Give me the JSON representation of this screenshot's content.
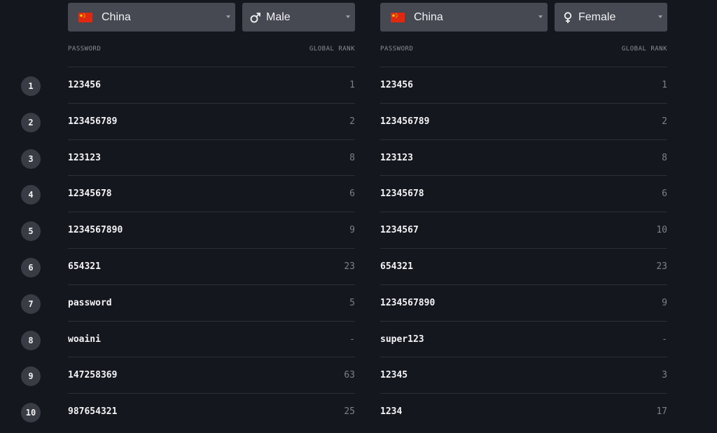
{
  "left": {
    "country": "China",
    "gender": "Male",
    "header_password": "PASSWORD",
    "header_rank": "GLOBAL RANK",
    "rows": [
      {
        "password": "123456",
        "rank": "1"
      },
      {
        "password": "123456789",
        "rank": "2"
      },
      {
        "password": "123123",
        "rank": "8"
      },
      {
        "password": "12345678",
        "rank": "6"
      },
      {
        "password": "1234567890",
        "rank": "9"
      },
      {
        "password": "654321",
        "rank": "23"
      },
      {
        "password": "password",
        "rank": "5"
      },
      {
        "password": "woaini",
        "rank": "-"
      },
      {
        "password": "147258369",
        "rank": "63"
      },
      {
        "password": "987654321",
        "rank": "25"
      }
    ]
  },
  "right": {
    "country": "China",
    "gender": "Female",
    "header_password": "PASSWORD",
    "header_rank": "GLOBAL RANK",
    "rows": [
      {
        "password": "123456",
        "rank": "1"
      },
      {
        "password": "123456789",
        "rank": "2"
      },
      {
        "password": "123123",
        "rank": "8"
      },
      {
        "password": "12345678",
        "rank": "6"
      },
      {
        "password": "1234567",
        "rank": "10"
      },
      {
        "password": "654321",
        "rank": "23"
      },
      {
        "password": "1234567890",
        "rank": "9"
      },
      {
        "password": "super123",
        "rank": "-"
      },
      {
        "password": "12345",
        "rank": "3"
      },
      {
        "password": "1234",
        "rank": "17"
      }
    ]
  },
  "row_numbers": [
    "1",
    "2",
    "3",
    "4",
    "5",
    "6",
    "7",
    "8",
    "9",
    "10"
  ],
  "icons": {
    "country_flag": "china-flag-icon",
    "male": "male-symbol-icon",
    "female": "female-symbol-icon",
    "dropdown": "caret-down-icon"
  },
  "colors": {
    "background": "#15171f",
    "select_bg": "#464852",
    "rank_badge_bg": "#3a3c45",
    "divider": "#2d2f37"
  }
}
